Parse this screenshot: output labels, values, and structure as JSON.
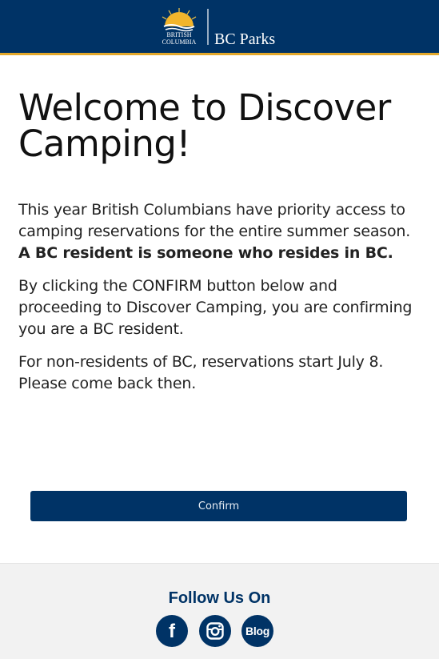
{
  "header": {
    "logo_line1": "BRITISH",
    "logo_line2": "COLUMBIA",
    "logo_brand": "BC Parks"
  },
  "main": {
    "title_line1": "Welcome to Discover",
    "title_line2": "Camping!",
    "p1_text": "This year British Columbians have priority access to camping reservations for the entire summer season. ",
    "p1_bold": "A BC resident is someone who resides in BC.",
    "p2": "By clicking the CONFIRM button below and proceeding to Discover Camping, you are confirming you are a BC resident.",
    "p3": "For non-residents of BC, reservations start July 8. Please come back then.",
    "confirm_label": "Confirm"
  },
  "footer": {
    "follow_label": "Follow Us On",
    "facebook_glyph": "f",
    "blog_label": "Blog"
  },
  "colors": {
    "brand_navy": "#003366",
    "accent_gold": "#e3a82b",
    "footer_bg": "#f2f2f2"
  },
  "icons": [
    "facebook-icon",
    "instagram-icon",
    "blog-icon"
  ]
}
